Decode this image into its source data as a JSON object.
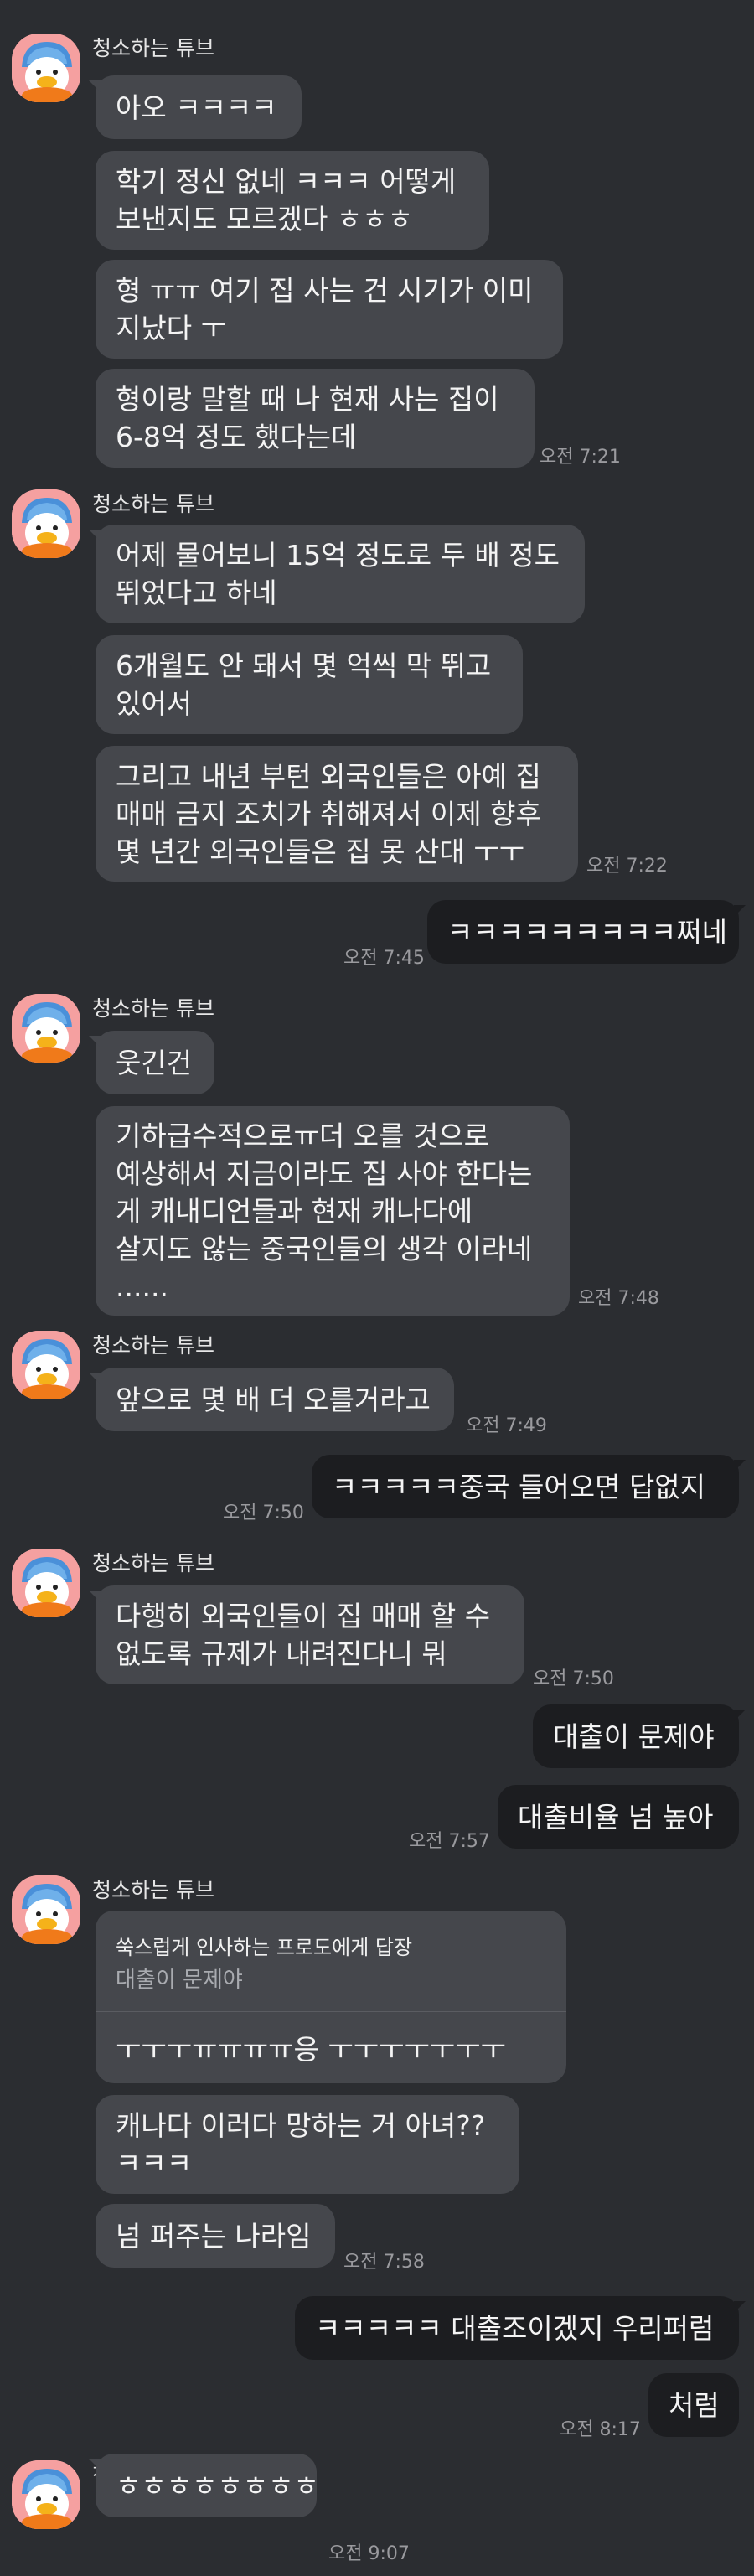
{
  "sender_name": "청소하는 튜브",
  "avatar_icon": "duck-tube-avatar-icon",
  "groups": [
    {
      "messages": [
        "아오 ㅋㅋㅋㅋ",
        "학기 정신 없네 ㅋㅋㅋ 어떻게|보낸지도 모르겠다 ㅎㅎㅎ",
        "형 ㅠㅠ 여기 집 사는 건 시기가 이미|지났다 ㅜ",
        "형이랑 말할 때 나 현재 사는 집이|6-8억 정도 했다는데"
      ],
      "time": "오전 7:21"
    },
    {
      "messages": [
        "어제 물어보니 15억 정도로 두 배 정도|뛰었다고 하네",
        "6개월도 안 돼서 몇 억씩 막 뛰고|있어서",
        "그리고 내년 부턴 외국인들은 아예 집|매매 금지 조치가 취해져서 이제 향후|몇 년간 외국인들은 집 못 산대 ㅜㅜ"
      ],
      "time": "오전 7:22"
    },
    {
      "messages": [
        "웃긴건",
        "기하급수적으로ㅠ더 오를 것으로|예상해서 지금이라도 집 사야 한다는|게 캐내디언들과 현재 캐나다에|살지도 않는 중국인들의 생각 이라네|......"
      ],
      "time": "오전 7:48"
    },
    {
      "messages": [
        "앞으로 몇 배 더 오를거라고"
      ],
      "time": "오전 7:49"
    },
    {
      "messages": [
        "다행히 외국인들이 집 매매 할 수|없도록 규제가 내려진다니 뭐"
      ],
      "time": "오전 7:50"
    },
    {
      "messages": [
        "넘 퍼주는 나라임"
      ],
      "time": "오전 7:58"
    },
    {
      "messages": [
        "ㅎㅎㅎㅎㅎㅎㅎㅎ"
      ],
      "time": "오전 9:07"
    }
  ],
  "outgoing": [
    {
      "messages": [
        "ㅋㅋㅋㅋㅋㅋㅋㅋㅋ쩌네"
      ],
      "time": "오전 7:45"
    },
    {
      "messages": [
        "ㅋㅋㅋㅋㅋ중국 들어오면 답없지"
      ],
      "time": "오전 7:50"
    },
    {
      "messages": [
        "대출이 문제야",
        "대출비율 넘 높아"
      ],
      "time": "오전 7:57"
    },
    {
      "messages": [
        "ㅋㅋㅋㅋㅋ 대출조이겠지 우리퍼럼",
        "처럼"
      ],
      "time": "오전 8:17"
    }
  ],
  "reply": {
    "header": "쑥스럽게 인사하는 프로도에게 답장",
    "quoted": "대출이 문제야",
    "text": "ㅜㅜㅜㅠㅠㅠㅠ응 ㅜㅜㅜㅜㅜㅜㅜ",
    "followup": "캐나다 이러다 망하는 거 아녀??|ㅋㅋㅋ"
  }
}
